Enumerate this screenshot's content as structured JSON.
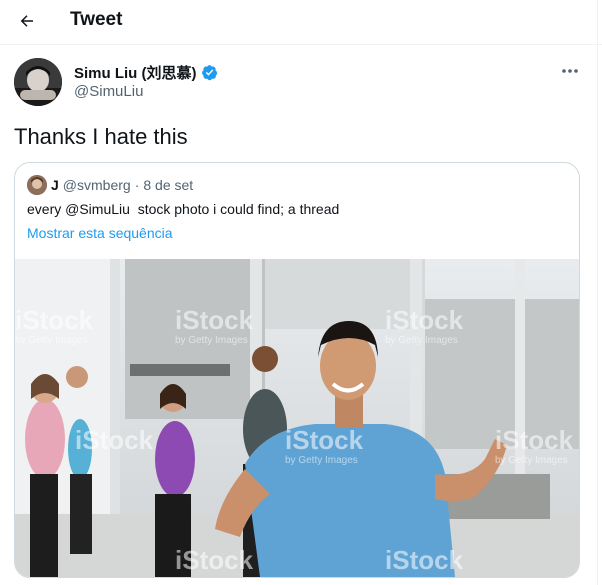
{
  "header": {
    "title": "Tweet",
    "back_icon": "arrow-left-icon"
  },
  "tweet": {
    "author_name": "Simu Liu (刘思慕)",
    "author_handle": "@SimuLiu",
    "verified_icon": "verified-badge-icon",
    "more_icon": "more-options-icon",
    "text": "Thanks I hate this"
  },
  "quoted": {
    "author_name": "J",
    "author_handle": "@svmberg",
    "separator": "·",
    "date": "8 de set",
    "text": "every @SimuLiu  stock photo i could find; a thread",
    "show_thread_link": "Mostrar esta sequência"
  },
  "photo": {
    "watermark": "iStock",
    "watermark_sub": "by Getty Images"
  },
  "colors": {
    "accent": "#1d9bf0",
    "muted": "#536471",
    "border": "#cfd9de"
  }
}
